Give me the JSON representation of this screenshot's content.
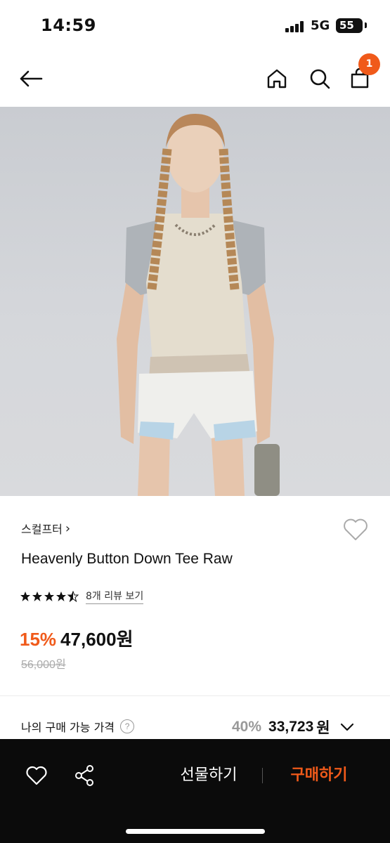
{
  "status_bar": {
    "time": "14:59",
    "network": "5G",
    "battery": "55"
  },
  "nav": {
    "icons": [
      "back-arrow-icon",
      "home-icon",
      "search-icon",
      "cart-icon"
    ],
    "cart_count": "1"
  },
  "product": {
    "brand": "스컬프터",
    "brand_chevron": "›",
    "name": "Heavenly Button Down Tee Raw",
    "rating": 4.5,
    "review_link": "8개 리뷰 보기",
    "discount": "15%",
    "price": "47,600원",
    "original_price": "56,000원"
  },
  "my_price": {
    "label": "나의 구매 가능 가격",
    "help": "?",
    "discount": "40%",
    "price": "33,723",
    "currency": "원"
  },
  "bottom_bar": {
    "gift_label": "선물하기",
    "buy_label": "구매하기"
  },
  "colors": {
    "accent": "#f05a1a",
    "bottom_bar": "#0b0b0b"
  }
}
